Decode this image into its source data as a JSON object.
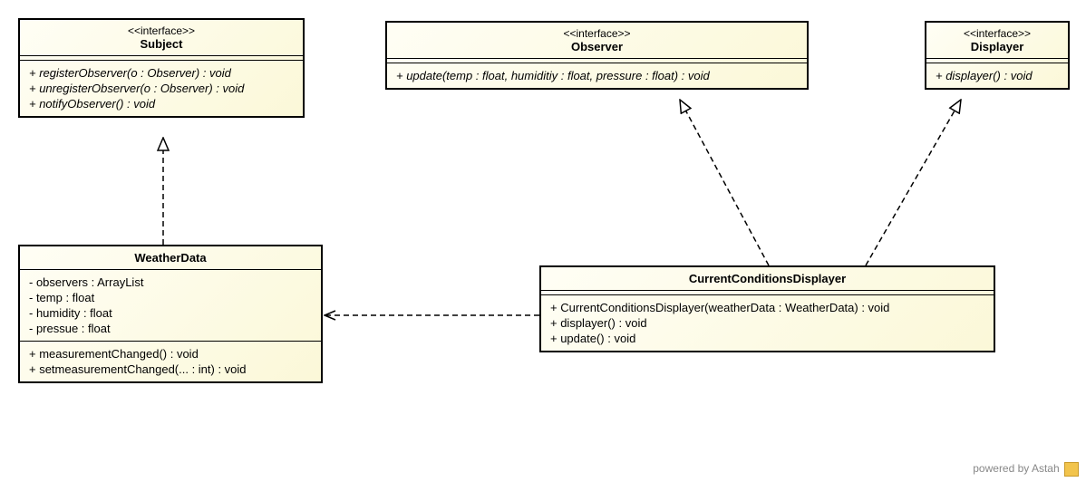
{
  "classes": {
    "subject": {
      "stereotype": "<<interface>>",
      "name": "Subject",
      "operations": [
        "+ registerObserver(o : Observer) : void",
        "+ unregisterObserver(o : Observer) : void",
        "+ notifyObserver() : void"
      ]
    },
    "observer": {
      "stereotype": "<<interface>>",
      "name": "Observer",
      "operations": [
        "+ update(temp : float, humiditiy : float, pressure : float) : void"
      ]
    },
    "displayer": {
      "stereotype": "<<interface>>",
      "name": "Displayer",
      "operations": [
        "+ displayer() : void"
      ]
    },
    "weatherData": {
      "name": "WeatherData",
      "attributes": [
        "- observers : ArrayList",
        "- temp : float",
        "- humidity : float",
        "- pressue : float"
      ],
      "operations": [
        "+ measurementChanged() : void",
        "+ setmeasurementChanged(... : int) : void"
      ]
    },
    "currentConditions": {
      "name": "CurrentConditionsDisplayer",
      "operations": [
        "+ CurrentConditionsDisplayer(weatherData : WeatherData) : void",
        "+ displayer() : void",
        "+ update() : void"
      ]
    }
  },
  "footer": "powered by Astah",
  "relationships": [
    {
      "from": "WeatherData",
      "to": "Subject",
      "type": "realization"
    },
    {
      "from": "CurrentConditionsDisplayer",
      "to": "Observer",
      "type": "realization"
    },
    {
      "from": "CurrentConditionsDisplayer",
      "to": "Displayer",
      "type": "realization"
    },
    {
      "from": "CurrentConditionsDisplayer",
      "to": "WeatherData",
      "type": "dependency"
    }
  ]
}
